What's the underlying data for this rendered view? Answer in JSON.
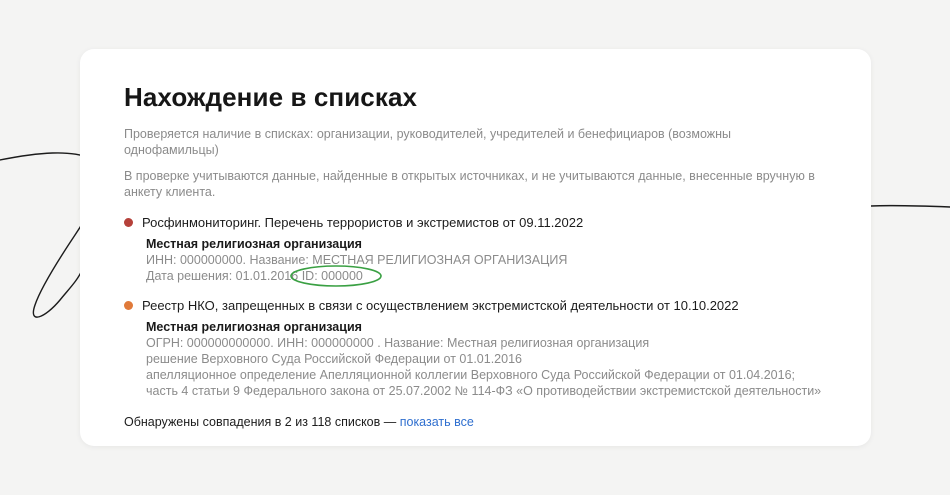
{
  "title": "Нахождение в списках",
  "desc1": "Проверяется наличие в списках: организации, руководителей, учредителей и бенефициаров (возможны однофамильцы)",
  "desc2": "В проверке учитываются данные, найденные в открытых источниках, и не учитываются данные, внесенные вручную в анкету клиента.",
  "entries": [
    {
      "status_color": "#b5413a",
      "title": "Росфинмониторинг. Перечень террористов и экстремистов от 09.11.2022",
      "org": "Местная религиозная организация",
      "line1": "ИНН: 000000000. Название: МЕСТНАЯ РЕЛИГИОЗНАЯ ОРГАНИЗАЦИЯ",
      "decision": "Дата решения:  01.01.2016",
      "id": "ID:  000000",
      "annotation_color": "#3aa043"
    },
    {
      "status_color": "#e07a3a",
      "title": "Реестр НКО, запрещенных в связи с осуществлением экстремистской деятельности от 10.10.2022",
      "org": "Местная религиозная организация",
      "lines": [
        "ОГРН: 000000000000. ИНН: 000000000 . Название: Местная религиозная организация",
        "решение Верховного Суда Российской Федерации от 01.01.2016",
        "апелляционное определение Апелляционной коллегии Верховного Суда Российской Федерации от 01.04.2016;",
        " часть 4 статьи 9 Федерального закона  от 25.07.2002 № 114-ФЗ «О противодействии экстремистской деятельности»"
      ]
    }
  ],
  "footer": {
    "text": "Обнаружены совпадения в 2 из 118 списков — ",
    "link": "показать все",
    "link_color": "#2f6fcf"
  }
}
